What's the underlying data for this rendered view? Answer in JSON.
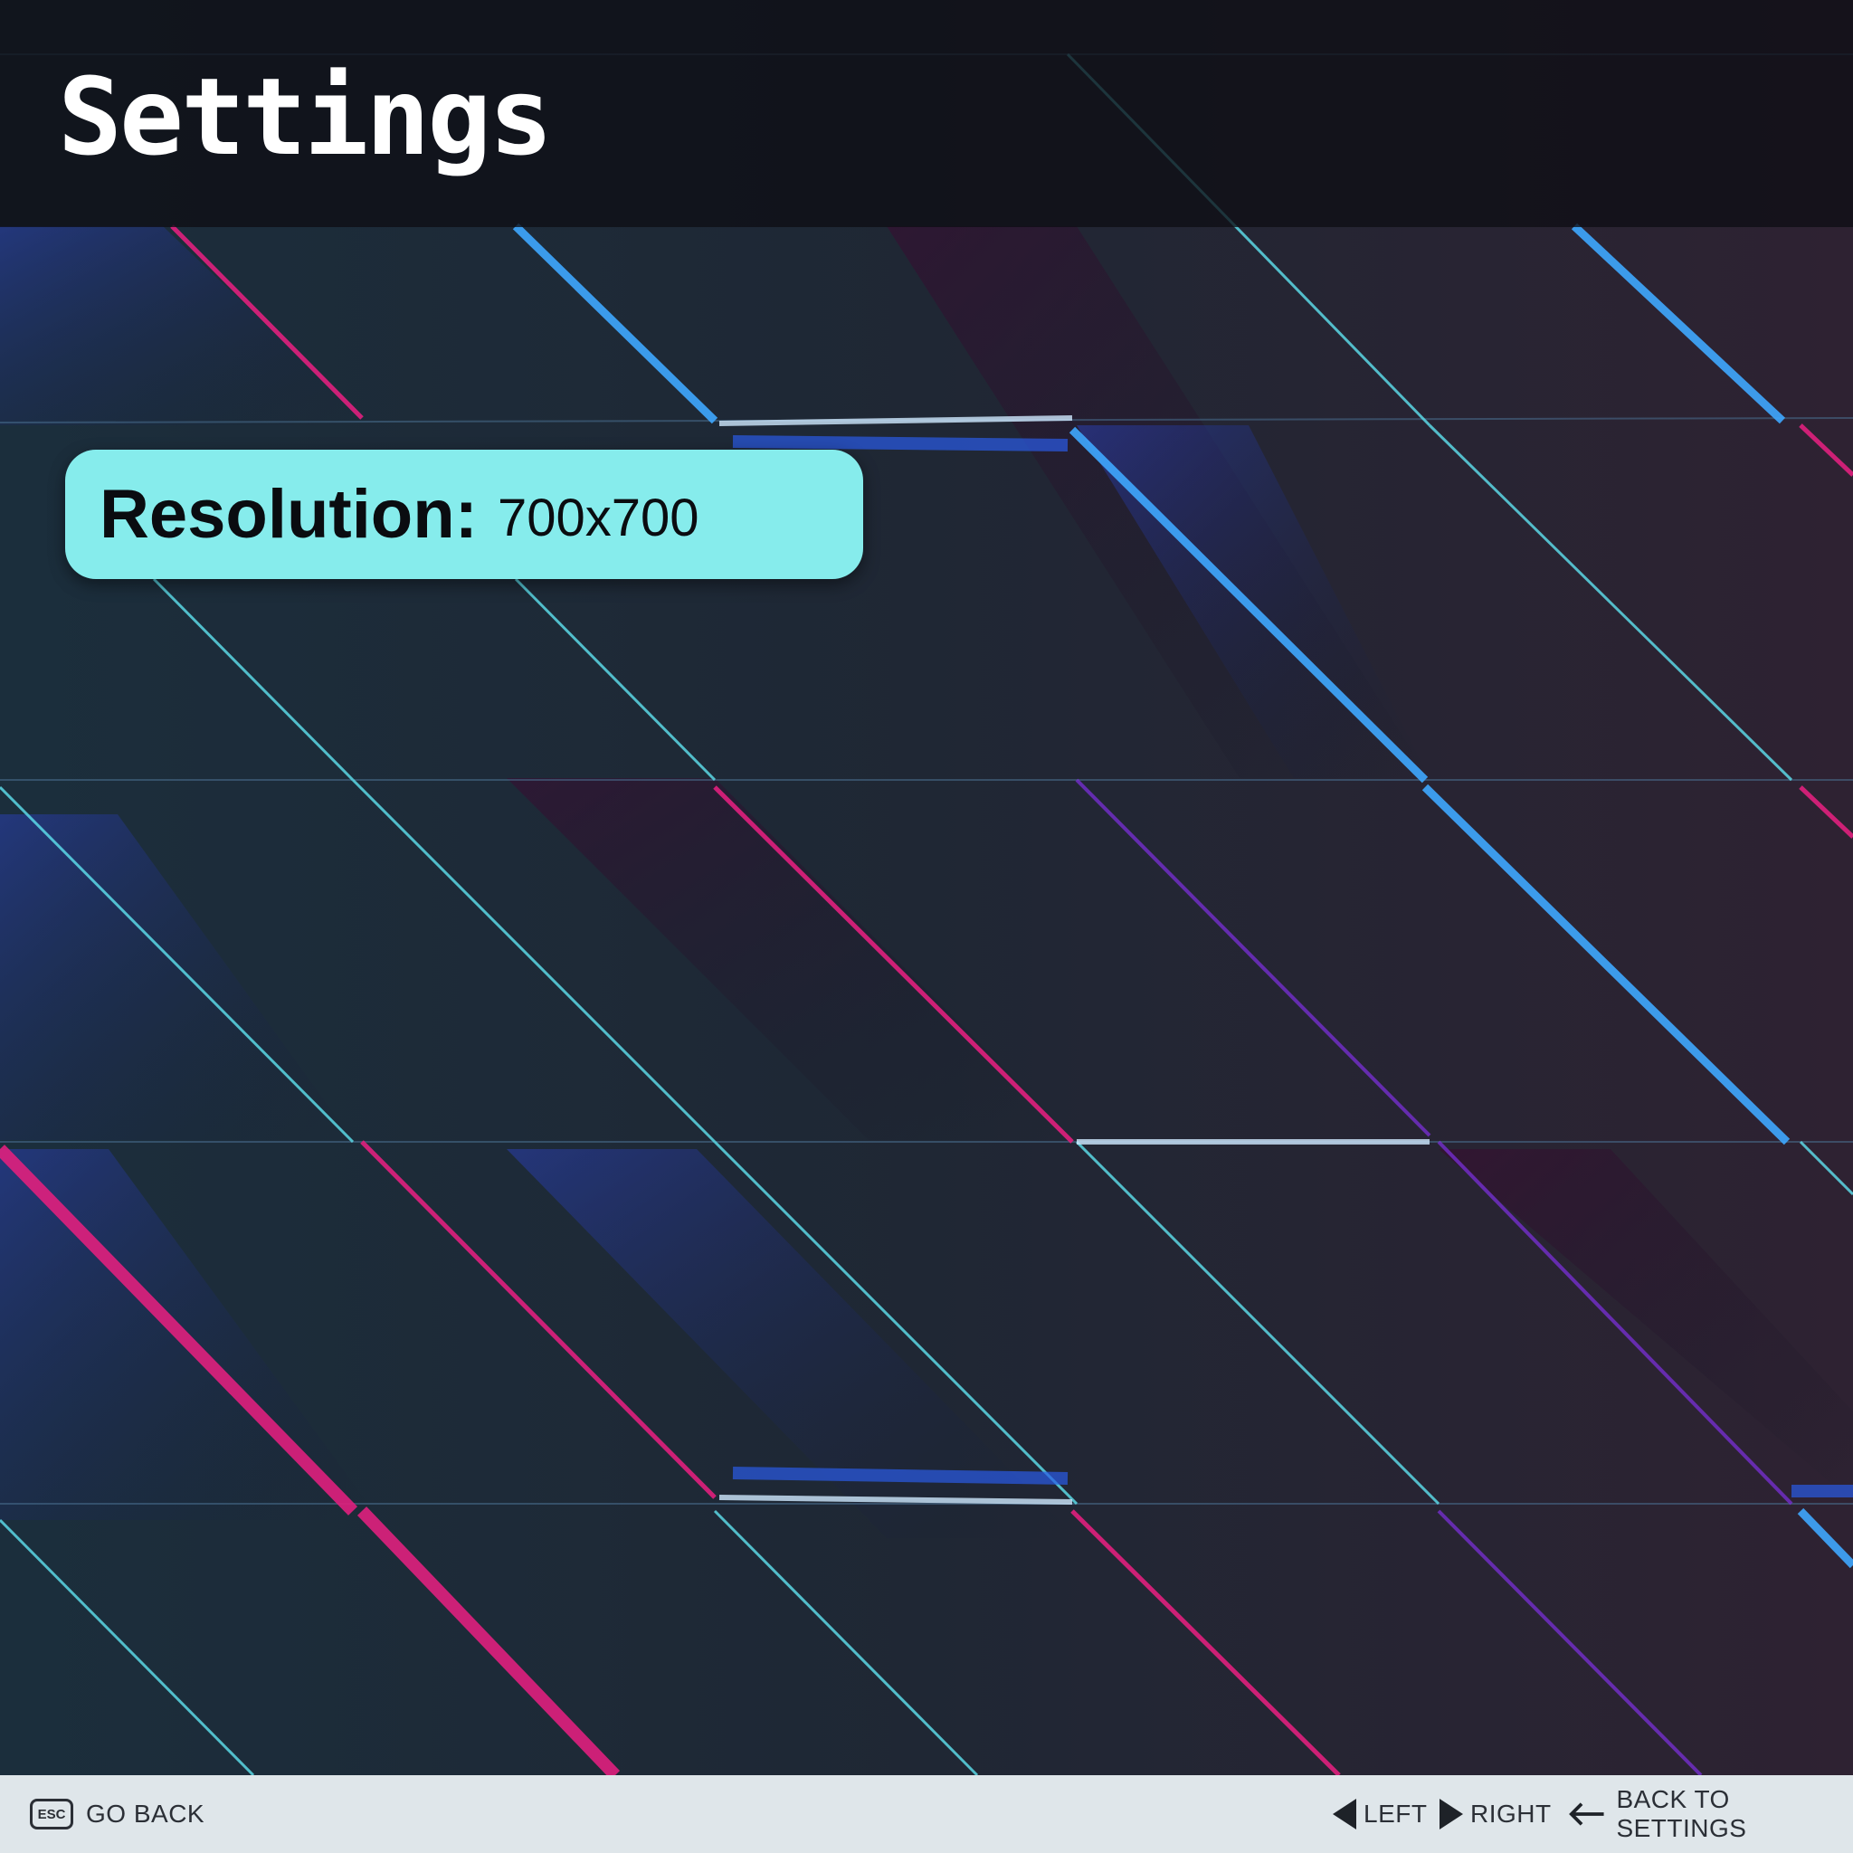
{
  "screen": {
    "title": "Settings"
  },
  "option": {
    "label": "Resolution:",
    "value": "700x700"
  },
  "footer": {
    "back": {
      "key": "ESC",
      "label": "GO BACK",
      "icon": "esc-key-icon"
    },
    "left": {
      "label": "LEFT",
      "icon": "triangle-left-icon"
    },
    "right": {
      "label": "RIGHT",
      "icon": "triangle-right-icon"
    },
    "back_to_settings": {
      "label": "BACK TO SETTINGS",
      "icon": "arrow-left-icon"
    }
  },
  "colors": {
    "header_bg": "#0e0e14",
    "option_bg": "#86ecec",
    "footer_bg": "#dfe6ea",
    "footer_text": "#2b2f36",
    "accent_cyan": "#5fe3f0",
    "accent_magenta": "#e0207e",
    "accent_blue": "#1e5ee8"
  }
}
